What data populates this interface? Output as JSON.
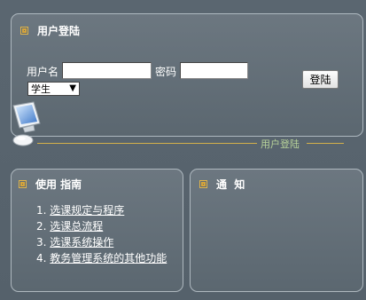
{
  "login": {
    "title": "用户登陆",
    "username_label": "用户名",
    "username_value": "",
    "password_label": "密码",
    "password_value": "",
    "role_selected": "学生",
    "submit_label": "登陆",
    "caption": "用户登陆"
  },
  "guide": {
    "title": "使用 指南",
    "items": [
      {
        "num": "1.",
        "label": "选课规定与程序"
      },
      {
        "num": "2.",
        "label": "选课总流程"
      },
      {
        "num": "3.",
        "label": "选课系统操作"
      },
      {
        "num": "4.",
        "label": "教务管理系统的其他功能"
      }
    ]
  },
  "notice": {
    "title": "通  知"
  },
  "colors": {
    "background": "#5a6670",
    "accent": "#d4b14a",
    "caption_text": "#b8d39a"
  }
}
